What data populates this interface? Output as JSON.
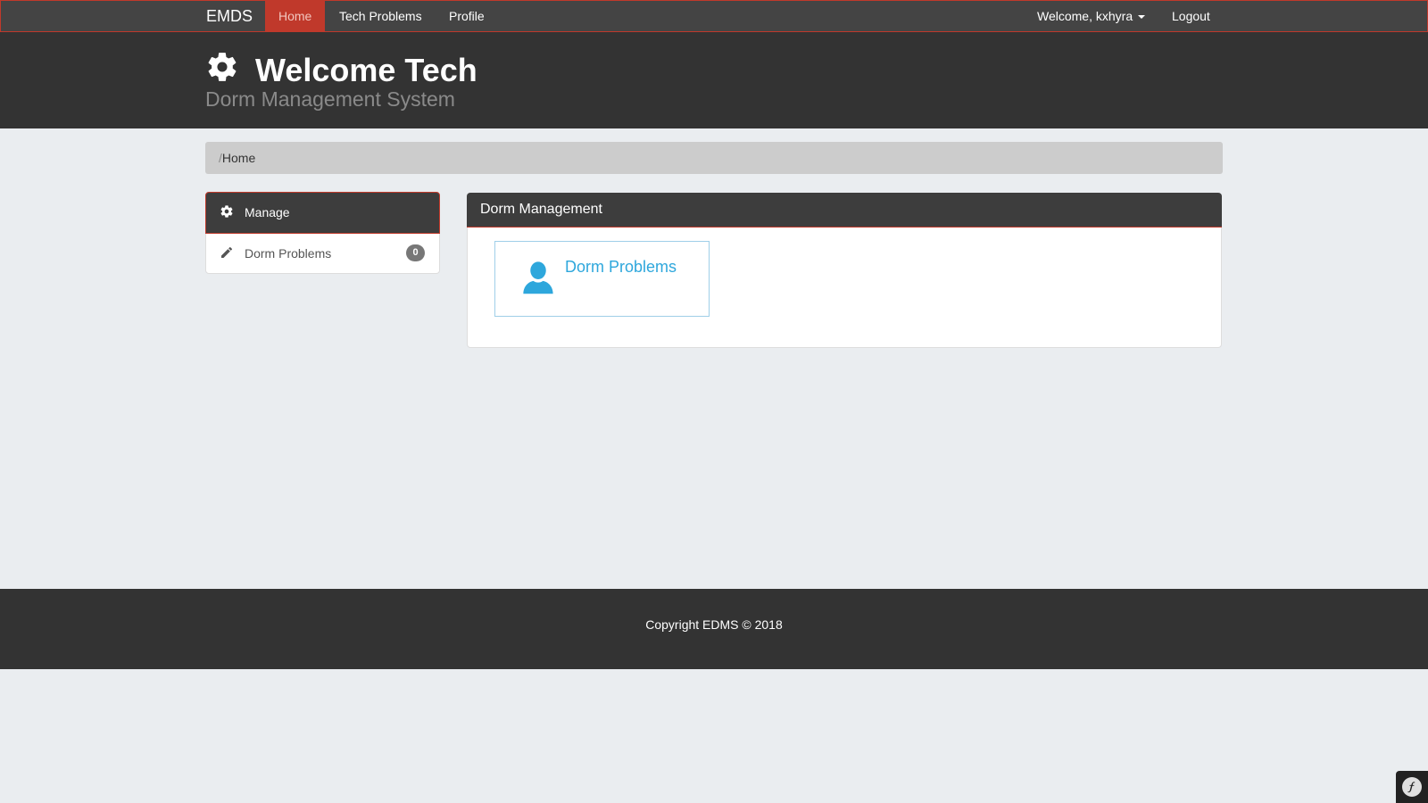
{
  "navbar": {
    "brand": "EMDS",
    "links": [
      {
        "label": "Home",
        "active": true
      },
      {
        "label": "Tech Problems"
      },
      {
        "label": "Profile"
      }
    ],
    "user_menu": "Welcome, kxhyra",
    "logout": "Logout"
  },
  "header": {
    "icon": "gear-icon",
    "title": "Welcome Tech",
    "subtitle": "Dorm Management System"
  },
  "breadcrumb": {
    "separator": "/",
    "current": "Home"
  },
  "sidebar": {
    "heading": "Manage",
    "heading_icon": "gear-icon",
    "items": [
      {
        "label": "Dorm Problems",
        "icon": "pencil-icon",
        "count": "0"
      }
    ]
  },
  "main": {
    "heading": "Dorm Management",
    "tiles": [
      {
        "label": "Dorm Problems",
        "icon": "user-icon"
      }
    ]
  },
  "footer": {
    "copyright": "Copyright EDMS © 2018"
  },
  "colors": {
    "accent": "#c0392b",
    "navbar_bg": "#444444",
    "header_bg": "#333333",
    "link_blue": "#2ea7dc",
    "page_bg": "#eaedf0"
  }
}
